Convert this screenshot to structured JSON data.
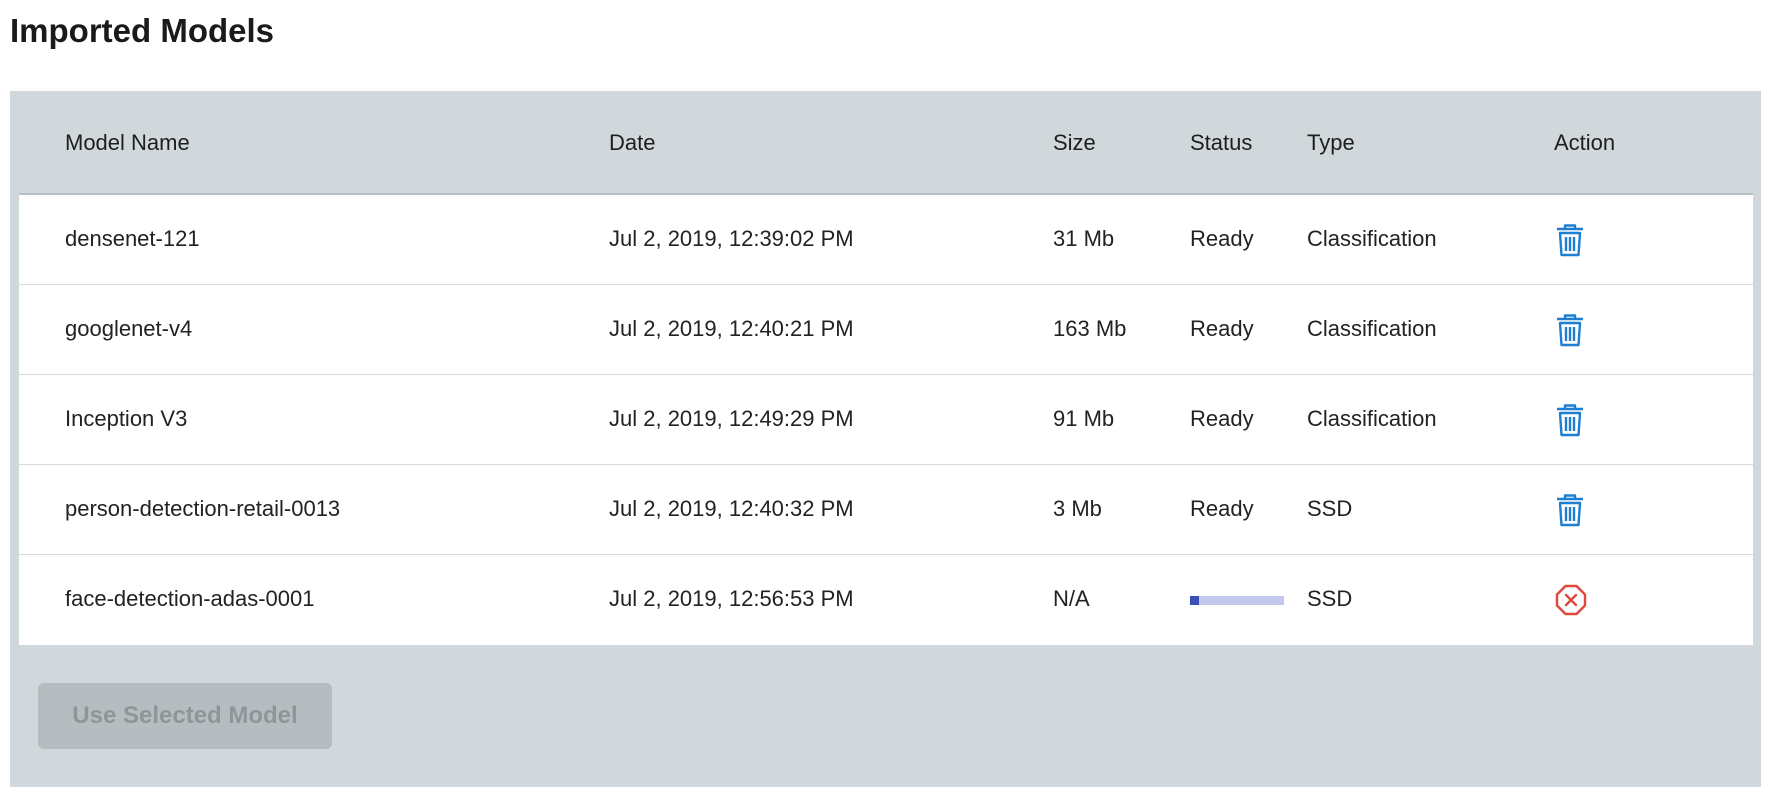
{
  "page": {
    "title": "Imported Models"
  },
  "table": {
    "columns": [
      "Model Name",
      "Date",
      "Size",
      "Status",
      "Type",
      "Action"
    ],
    "rows": [
      {
        "name": "densenet-121",
        "date": "Jul 2, 2019, 12:39:02 PM",
        "size": "31 Mb",
        "status": "Ready",
        "type": "Classification",
        "action_icon": "trash-icon"
      },
      {
        "name": "googlenet-v4",
        "date": "Jul 2, 2019, 12:40:21 PM",
        "size": "163 Mb",
        "status": "Ready",
        "type": "Classification",
        "action_icon": "trash-icon"
      },
      {
        "name": "Inception V3",
        "date": "Jul 2, 2019, 12:49:29 PM",
        "size": "91 Mb",
        "status": "Ready",
        "type": "Classification",
        "action_icon": "trash-icon"
      },
      {
        "name": "person-detection-retail-0013",
        "date": "Jul 2, 2019, 12:40:32 PM",
        "size": "3 Mb",
        "status": "Ready",
        "type": "SSD",
        "action_icon": "trash-icon"
      },
      {
        "name": "face-detection-adas-0001",
        "date": "Jul 2, 2019, 12:56:53 PM",
        "size": "N/A",
        "status_progress": 0.1,
        "type": "SSD",
        "action_icon": "cancel-icon"
      }
    ]
  },
  "footer": {
    "use_selected_label": "Use Selected Model",
    "use_selected_disabled": true
  },
  "colors": {
    "panel_bg": "#d1d8db",
    "trash_icon": "#1e7fd2",
    "cancel_icon": "#e0483c",
    "progress_track": "#c3c9ee",
    "progress_fill": "#3a4fb5",
    "button_disabled_bg": "#b6bcbf"
  }
}
